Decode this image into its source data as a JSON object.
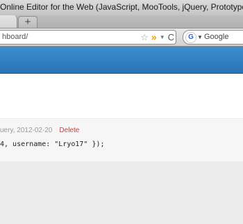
{
  "window": {
    "title": "Online Editor for the Web (JavaScript, MooTools, jQuery, Prototype,"
  },
  "tabs": {
    "new_tab_label": "+"
  },
  "toolbar": {
    "url": "hboard/",
    "search_placeholder": "Google",
    "search_engine_letter": "G"
  },
  "icons": {
    "star": "☆",
    "rss": "»",
    "dropdown": "▼",
    "reload": "C"
  },
  "entry": {
    "meta": "uery, 2012-02-20",
    "delete_label": "Delete",
    "code": "4, username: \"Lryo17\" });"
  },
  "colors": {
    "header_blue": "#2f7fc1",
    "delete_red": "#d13a3a"
  }
}
